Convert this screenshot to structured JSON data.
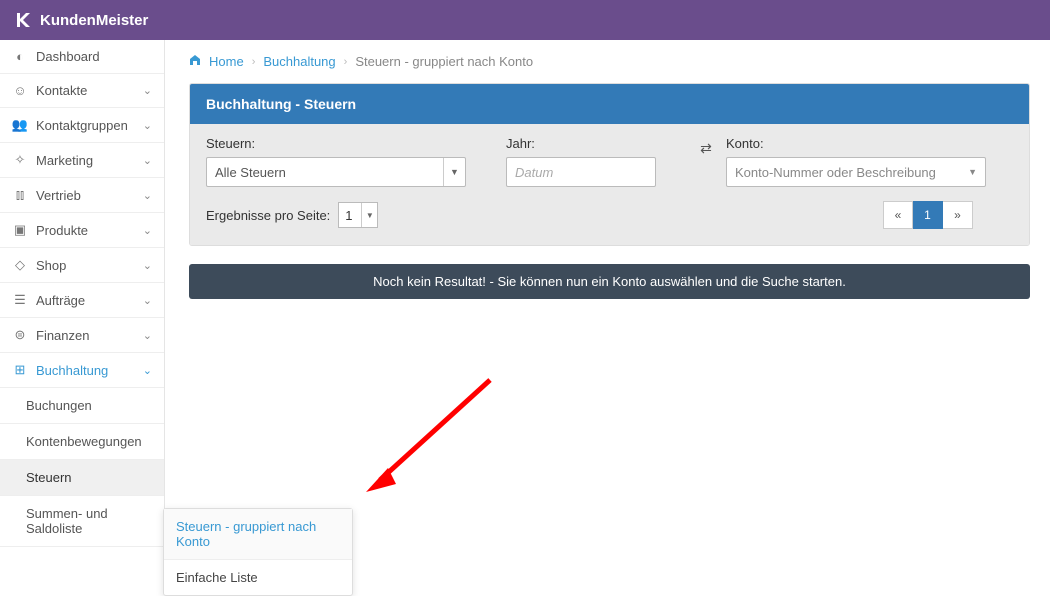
{
  "brand": "KundenMeister",
  "breadcrumb": {
    "home": "Home",
    "section": "Buchhaltung",
    "page": "Steuern - gruppiert nach Konto"
  },
  "sidebar": {
    "items": [
      {
        "label": "Dashboard"
      },
      {
        "label": "Kontakte"
      },
      {
        "label": "Kontaktgruppen"
      },
      {
        "label": "Marketing"
      },
      {
        "label": "Vertrieb"
      },
      {
        "label": "Produkte"
      },
      {
        "label": "Shop"
      },
      {
        "label": "Aufträge"
      },
      {
        "label": "Finanzen"
      },
      {
        "label": "Buchhaltung"
      }
    ],
    "sub": [
      {
        "label": "Buchungen"
      },
      {
        "label": "Kontenbewegungen"
      },
      {
        "label": "Steuern"
      },
      {
        "label": "Summen- und Saldoliste"
      }
    ]
  },
  "flyout": {
    "items": [
      {
        "label": "Steuern - gruppiert nach Konto"
      },
      {
        "label": "Einfache Liste"
      }
    ]
  },
  "panel": {
    "title": "Buchhaltung - Steuern",
    "filters": {
      "steuern_label": "Steuern:",
      "steuern_value": "Alle Steuern",
      "jahr_label": "Jahr:",
      "jahr_placeholder": "Datum",
      "konto_label": "Konto:",
      "konto_placeholder": "Konto-Nummer oder Beschreibung"
    },
    "results_label": "Ergebnisse pro Seite:",
    "results_value": "1",
    "pager": {
      "prev": "«",
      "page": "1",
      "next": "»"
    },
    "empty": "Noch kein Resultat! - Sie können nun ein Konto auswählen und die Suche starten."
  }
}
